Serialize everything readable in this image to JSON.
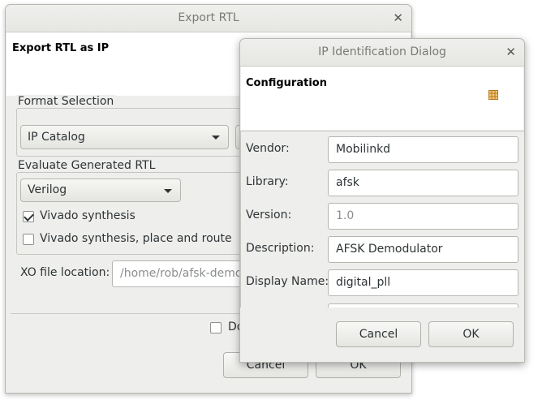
{
  "export_dialog": {
    "title": "Export RTL",
    "header": "Export RTL as IP",
    "format_selection": {
      "group_label": "Format Selection",
      "format_value": "IP Catalog"
    },
    "evaluate": {
      "group_label": "Evaluate Generated RTL",
      "language_value": "Verilog",
      "vivado_synthesis_label": "Vivado synthesis",
      "vivado_synthesis_checked": true,
      "vivado_pnr_label": "Vivado synthesis, place and route",
      "vivado_pnr_checked": false
    },
    "xo": {
      "label": "XO file location:",
      "value": "/home/rob/afsk-demod"
    },
    "do_checkbox_label": "Do",
    "cancel_label": "Cancel",
    "ok_label": "OK"
  },
  "ip_dialog": {
    "title": "IP Identification Dialog",
    "header": "Configuration",
    "header_icon": "grid-config-icon",
    "fields": [
      {
        "label": "Vendor:",
        "value": "Mobilinkd",
        "disabled": false
      },
      {
        "label": "Library:",
        "value": "afsk",
        "disabled": false
      },
      {
        "label": "Version:",
        "value": "1.0",
        "disabled": true
      },
      {
        "label": "Description:",
        "value": "AFSK Demodulator",
        "disabled": false
      },
      {
        "label": "Display Name:",
        "value": "digital_pll",
        "disabled": false
      }
    ],
    "cancel_label": "Cancel",
    "ok_label": "OK"
  },
  "colors": {
    "dialog_bg": "#eeeeec",
    "titlebar_text": "#7a7a76",
    "icon_accent": "#e8a33a"
  }
}
